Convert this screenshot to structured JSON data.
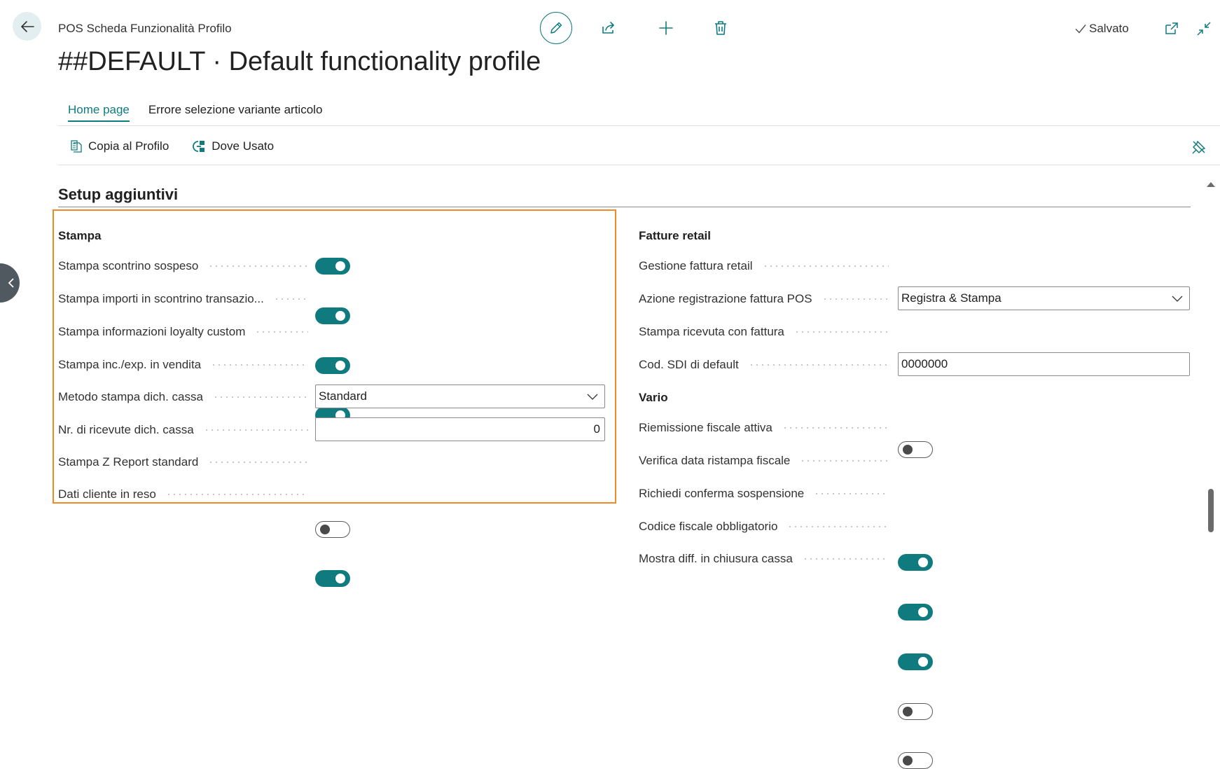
{
  "header": {
    "breadcrumb": "POS Scheda Funzionalità Profilo",
    "title": "##DEFAULT · Default functionality profile",
    "saved_label": "Salvato"
  },
  "tabs": [
    {
      "label": "Home page",
      "active": true
    },
    {
      "label": "Errore selezione variante articolo",
      "active": false
    }
  ],
  "actions": {
    "copy_label": "Copia al Profilo",
    "where_used_label": "Dove Usato"
  },
  "section": {
    "title": "Setup aggiuntivi"
  },
  "left_group": {
    "title": "Stampa",
    "fields": [
      {
        "label": "Stampa scontrino sospeso",
        "type": "toggle",
        "value": true
      },
      {
        "label": "Stampa importi in scontrino transazio...",
        "type": "toggle",
        "value": true
      },
      {
        "label": "Stampa informazioni loyalty custom",
        "type": "toggle",
        "value": true
      },
      {
        "label": "Stampa inc./exp. in vendita",
        "type": "toggle",
        "value": true
      },
      {
        "label": "Metodo stampa dich. cassa",
        "type": "select",
        "value": "Standard"
      },
      {
        "label": "Nr. di ricevute dich. cassa",
        "type": "number",
        "value": "0"
      },
      {
        "label": "Stampa Z Report standard",
        "type": "toggle",
        "value": false
      },
      {
        "label": "Dati cliente in reso",
        "type": "toggle",
        "value": true
      }
    ]
  },
  "right_group": {
    "title": "Fatture retail",
    "fields": [
      {
        "label": "Gestione fattura retail",
        "type": "toggle",
        "value": false
      },
      {
        "label": "Azione registrazione fattura POS",
        "type": "select",
        "value": "Registra & Stampa"
      },
      {
        "label": "Stampa ricevuta con fattura",
        "type": "toggle",
        "value": false
      },
      {
        "label": "Cod. SDI di default",
        "type": "text",
        "value": "0000000"
      }
    ]
  },
  "right_group2": {
    "title": "Vario",
    "fields": [
      {
        "label": "Riemissione fiscale attiva",
        "type": "toggle",
        "value": true
      },
      {
        "label": "Verifica data ristampa fiscale",
        "type": "toggle",
        "value": true
      },
      {
        "label": "Richiedi conferma sospensione",
        "type": "toggle",
        "value": true
      },
      {
        "label": "Codice fiscale obbligatorio",
        "type": "toggle",
        "value": false
      },
      {
        "label": "Mostra diff. in chiusura cassa",
        "type": "toggle",
        "value": false
      }
    ]
  },
  "icons": {
    "back": "arrow-left-icon",
    "edit": "pencil-icon",
    "share": "share-icon",
    "new": "plus-icon",
    "delete": "trash-icon",
    "saved": "checkmark-icon",
    "open_new_window": "open-in-new-window-icon",
    "collapse": "collapse-icon",
    "copy": "copy-profile-icon",
    "where_used": "where-used-icon",
    "pin": "unpin-icon"
  },
  "colors": {
    "accent": "#0f7b7f",
    "highlight_border": "#f08a24",
    "toggle_off_knob": "#4a4a4a"
  }
}
